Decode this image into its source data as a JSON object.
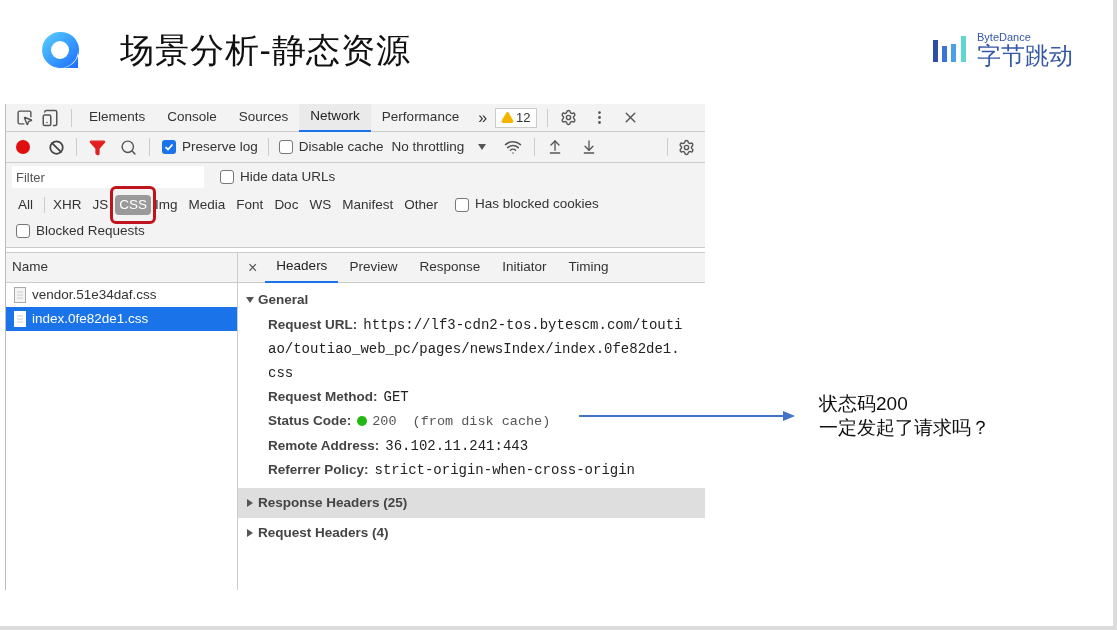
{
  "slide": {
    "title": "场景分析-静态资源",
    "brand": {
      "name_en": "ByteDance",
      "name_cn": "字节跳动"
    }
  },
  "devtools": {
    "panel_tabs": [
      {
        "label": "Elements",
        "selected": false
      },
      {
        "label": "Console",
        "selected": false
      },
      {
        "label": "Sources",
        "selected": false
      },
      {
        "label": "Network",
        "selected": true
      },
      {
        "label": "Performance",
        "selected": false
      }
    ],
    "more": "»",
    "warnings": "12",
    "toolbar": {
      "recording": true,
      "preserve_log": {
        "label": "Preserve log",
        "checked": true
      },
      "disable_cache": {
        "label": "Disable cache",
        "checked": false
      },
      "throttling": "No throttling"
    },
    "filter": {
      "placeholder": "Filter"
    },
    "hide_data_urls": {
      "label": "Hide data URLs",
      "checked": false
    },
    "types": [
      {
        "label": "All",
        "selected": false
      },
      {
        "label": "XHR",
        "selected": false
      },
      {
        "label": "JS",
        "selected": false
      },
      {
        "label": "CSS",
        "selected": true,
        "circled": true
      },
      {
        "label": "Img",
        "selected": false
      },
      {
        "label": "Media",
        "selected": false
      },
      {
        "label": "Font",
        "selected": false
      },
      {
        "label": "Doc",
        "selected": false
      },
      {
        "label": "WS",
        "selected": false
      },
      {
        "label": "Manifest",
        "selected": false
      },
      {
        "label": "Other",
        "selected": false
      }
    ],
    "has_blocked_cookies": {
      "label": "Has blocked cookies",
      "checked": false
    },
    "blocked_requests": {
      "label": "Blocked Requests",
      "checked": false
    },
    "requests": {
      "column": "Name",
      "rows": [
        {
          "name": "vendor.51e34daf.css",
          "selected": false
        },
        {
          "name": "index.0fe82de1.css",
          "selected": true
        }
      ]
    },
    "detail_close": "×",
    "detail_tabs": [
      {
        "label": "Headers",
        "selected": true
      },
      {
        "label": "Preview",
        "selected": false
      },
      {
        "label": "Response",
        "selected": false
      },
      {
        "label": "Initiator",
        "selected": false
      },
      {
        "label": "Timing",
        "selected": false
      }
    ],
    "general": {
      "title": "General",
      "expanded": true,
      "fields": [
        {
          "kind": "text",
          "label": "Request URL:",
          "value": "https://lf3-cdn2-tos.bytescm.com/toutiao/toutiao_web_pc/pages/newsIndex/index.0fe82de1.css"
        },
        {
          "kind": "text",
          "label": "Request Method:",
          "value": "GET"
        },
        {
          "kind": "status",
          "label": "Status Code:",
          "value": "200",
          "note": "(from disk cache)",
          "color": "#22b814"
        },
        {
          "kind": "text",
          "label": "Remote Address:",
          "value": "36.102.11.241:443"
        },
        {
          "kind": "text",
          "label": "Referrer Policy:",
          "value": "strict-origin-when-cross-origin"
        }
      ]
    },
    "sections": [
      {
        "title": "Response Headers (25)",
        "expanded": false,
        "highlighted": true
      },
      {
        "title": "Request Headers (4)",
        "expanded": false,
        "highlighted": false
      }
    ]
  },
  "annotation": {
    "lines": [
      "状态码200",
      "一定发起了请求吗？"
    ]
  }
}
